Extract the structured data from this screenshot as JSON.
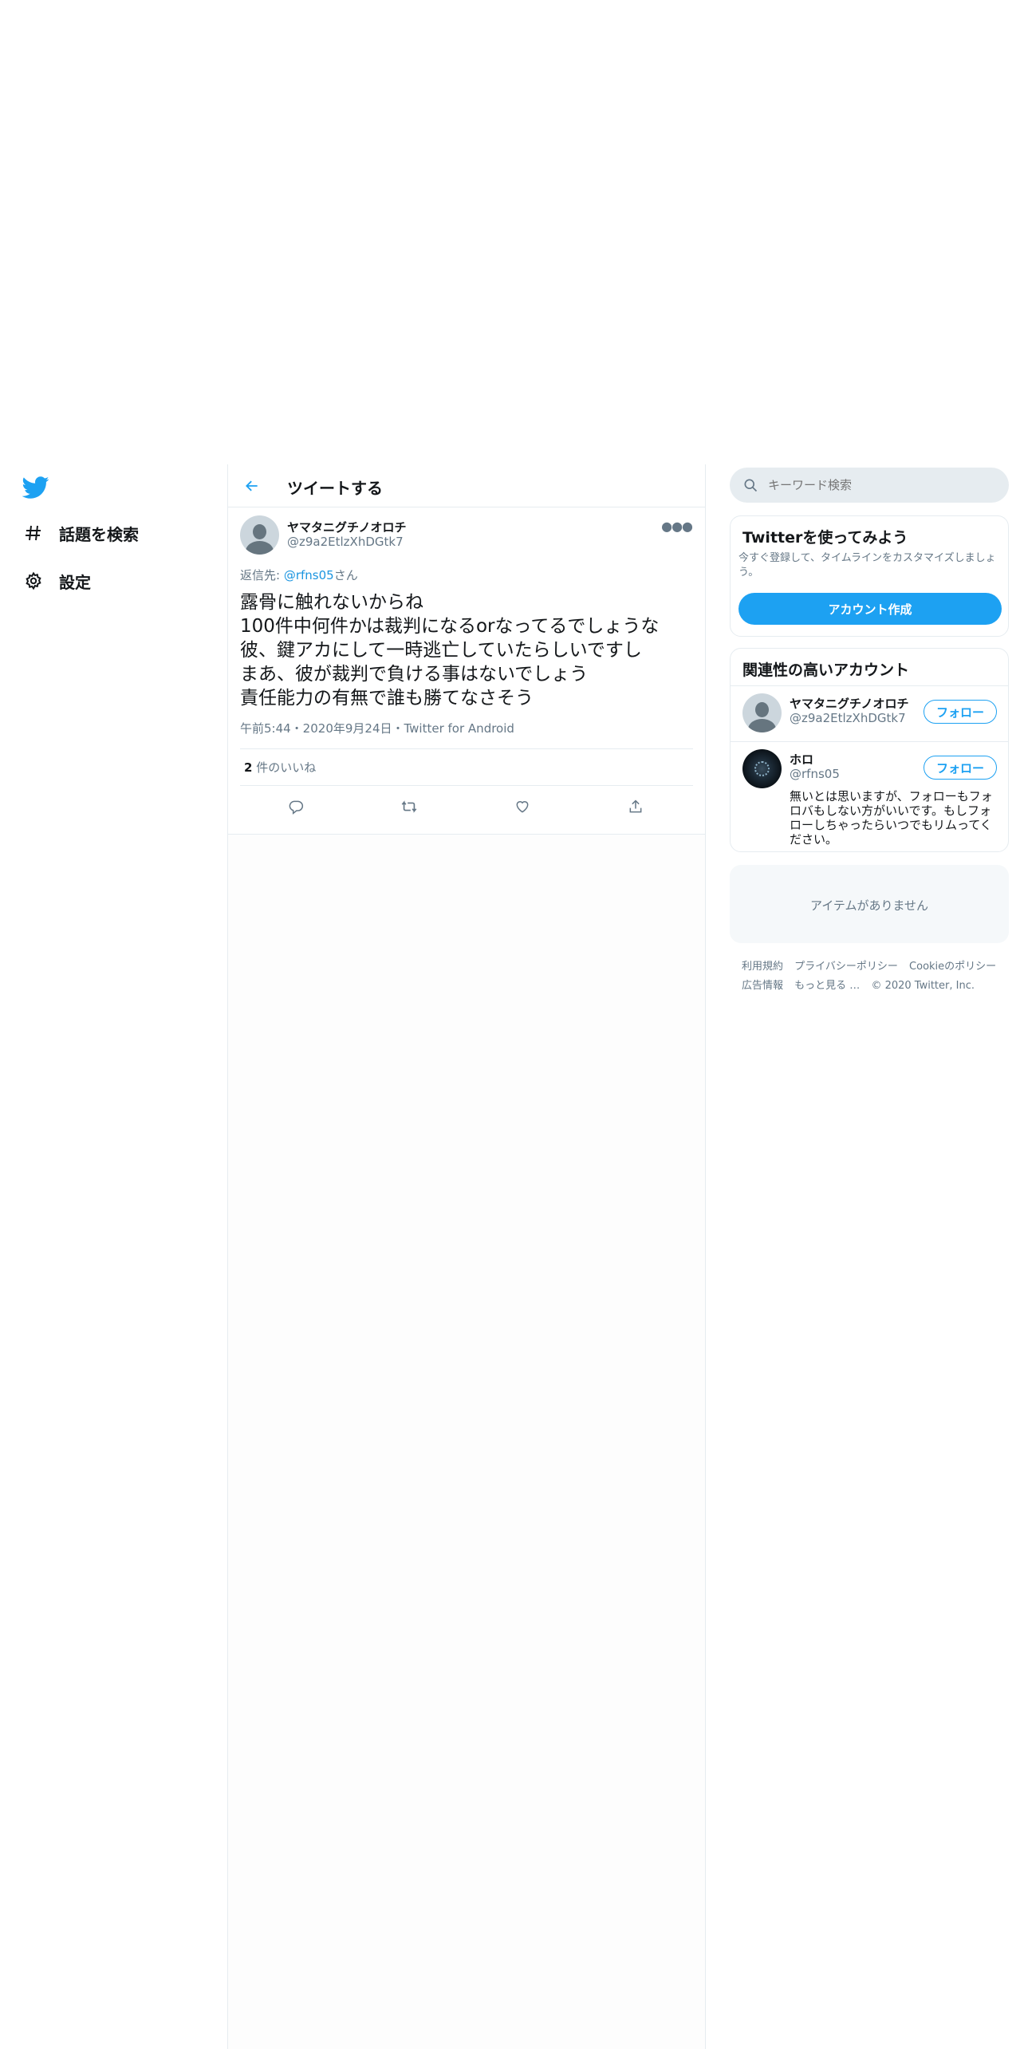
{
  "nav": {
    "items": [
      {
        "label": "話題を検索",
        "icon": "hashtag-icon"
      },
      {
        "label": "設定",
        "icon": "gear-icon"
      }
    ]
  },
  "header": {
    "title": "ツイートする"
  },
  "tweet": {
    "name": "ヤマタニグチノオロチ",
    "handle": "@z9a2EtlzXhDGtk7",
    "reply_prefix": "返信先: ",
    "reply_to": "@rfns05",
    "reply_suffix": "さん",
    "text": "露骨に触れないからね\n100件中何件かは裁判になるorなってるでしょうな\n彼、鍵アカにして一時逃亡していたらしいですし\nまあ、彼が裁判で負ける事はないでしょう\n責任能力の有無で誰も勝てなさそう",
    "meta": "午前5:44・2020年9月24日・Twitter for Android",
    "likes_count": "2",
    "likes_label": " 件のいいね"
  },
  "search": {
    "placeholder": "キーワード検索"
  },
  "signup": {
    "title": "Twitterを使ってみよう",
    "desc": "今すぐ登録して、タイムラインをカスタマイズしましょう。",
    "button": "アカウント作成"
  },
  "related": {
    "title": "関連性の高いアカウント",
    "accounts": [
      {
        "name": "ヤマタニグチノオロチ",
        "handle": "@z9a2EtlzXhDGtk7",
        "follow": "フォロー"
      },
      {
        "name": "ホロ",
        "handle": "@rfns05",
        "follow": "フォロー",
        "bio": "無いとは思いますが、フォローもフォロバもしない方がいいです。もしフォローしちゃったらいつでもリムってください。"
      }
    ]
  },
  "trends": {
    "empty": "アイテムがありません"
  },
  "footer": {
    "links": [
      "利用規約",
      "プライバシーポリシー",
      "Cookieのポリシー",
      "広告情報",
      "もっと見る …"
    ],
    "copyright": "© 2020 Twitter, Inc."
  },
  "colors": {
    "accent": "#1da1f2",
    "text": "#14171a",
    "muted": "#657786",
    "border": "#e6ecf0"
  }
}
